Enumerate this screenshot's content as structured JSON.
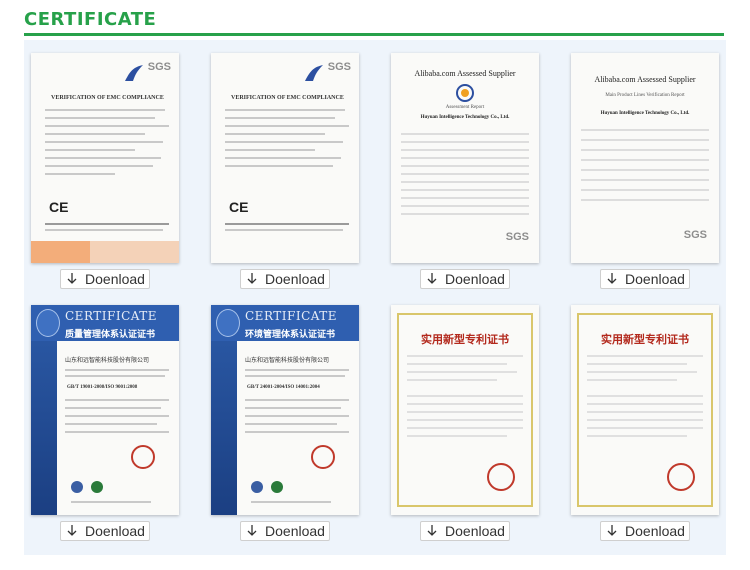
{
  "header": {
    "title": "CERTIFICATE"
  },
  "download_label": "Doenload",
  "certificates": [
    {
      "kind": "sgs",
      "title": "VERIFICATION OF EMC COMPLIANCE",
      "logo": "SGS"
    },
    {
      "kind": "sgs",
      "title": "VERIFICATION OF EMC COMPLIANCE",
      "logo": "SGS"
    },
    {
      "kind": "alibaba",
      "title": "Alibaba.com Assessed Supplier",
      "subtitle": "Assessment Report",
      "company": "Huyuan Intelligence Technology Co., Ltd."
    },
    {
      "kind": "alibaba2",
      "title": "Alibaba.com Assessed Supplier",
      "subtitle": "Main Product Lines Verification Report",
      "company": "Huyuan Intelligence Technology Co., Ltd."
    },
    {
      "kind": "cqm",
      "en": "CERTIFICATE",
      "cn": "质量管理体系认证证书",
      "org": "山东和远智能科技股份有限公司",
      "standard": "GB/T 19001-2008/ISO 9001:2008"
    },
    {
      "kind": "cqm",
      "en": "CERTIFICATE",
      "cn": "环境管理体系认证证书",
      "org": "山东和远智能科技股份有限公司",
      "standard": "GB/T 24001-2004/ISO 14001:2004"
    },
    {
      "kind": "patent",
      "cn": "实用新型专利证书"
    },
    {
      "kind": "patent",
      "cn": "实用新型专利证书"
    }
  ],
  "colors": {
    "accent": "#27a14a",
    "panel": "#eef4fb"
  }
}
